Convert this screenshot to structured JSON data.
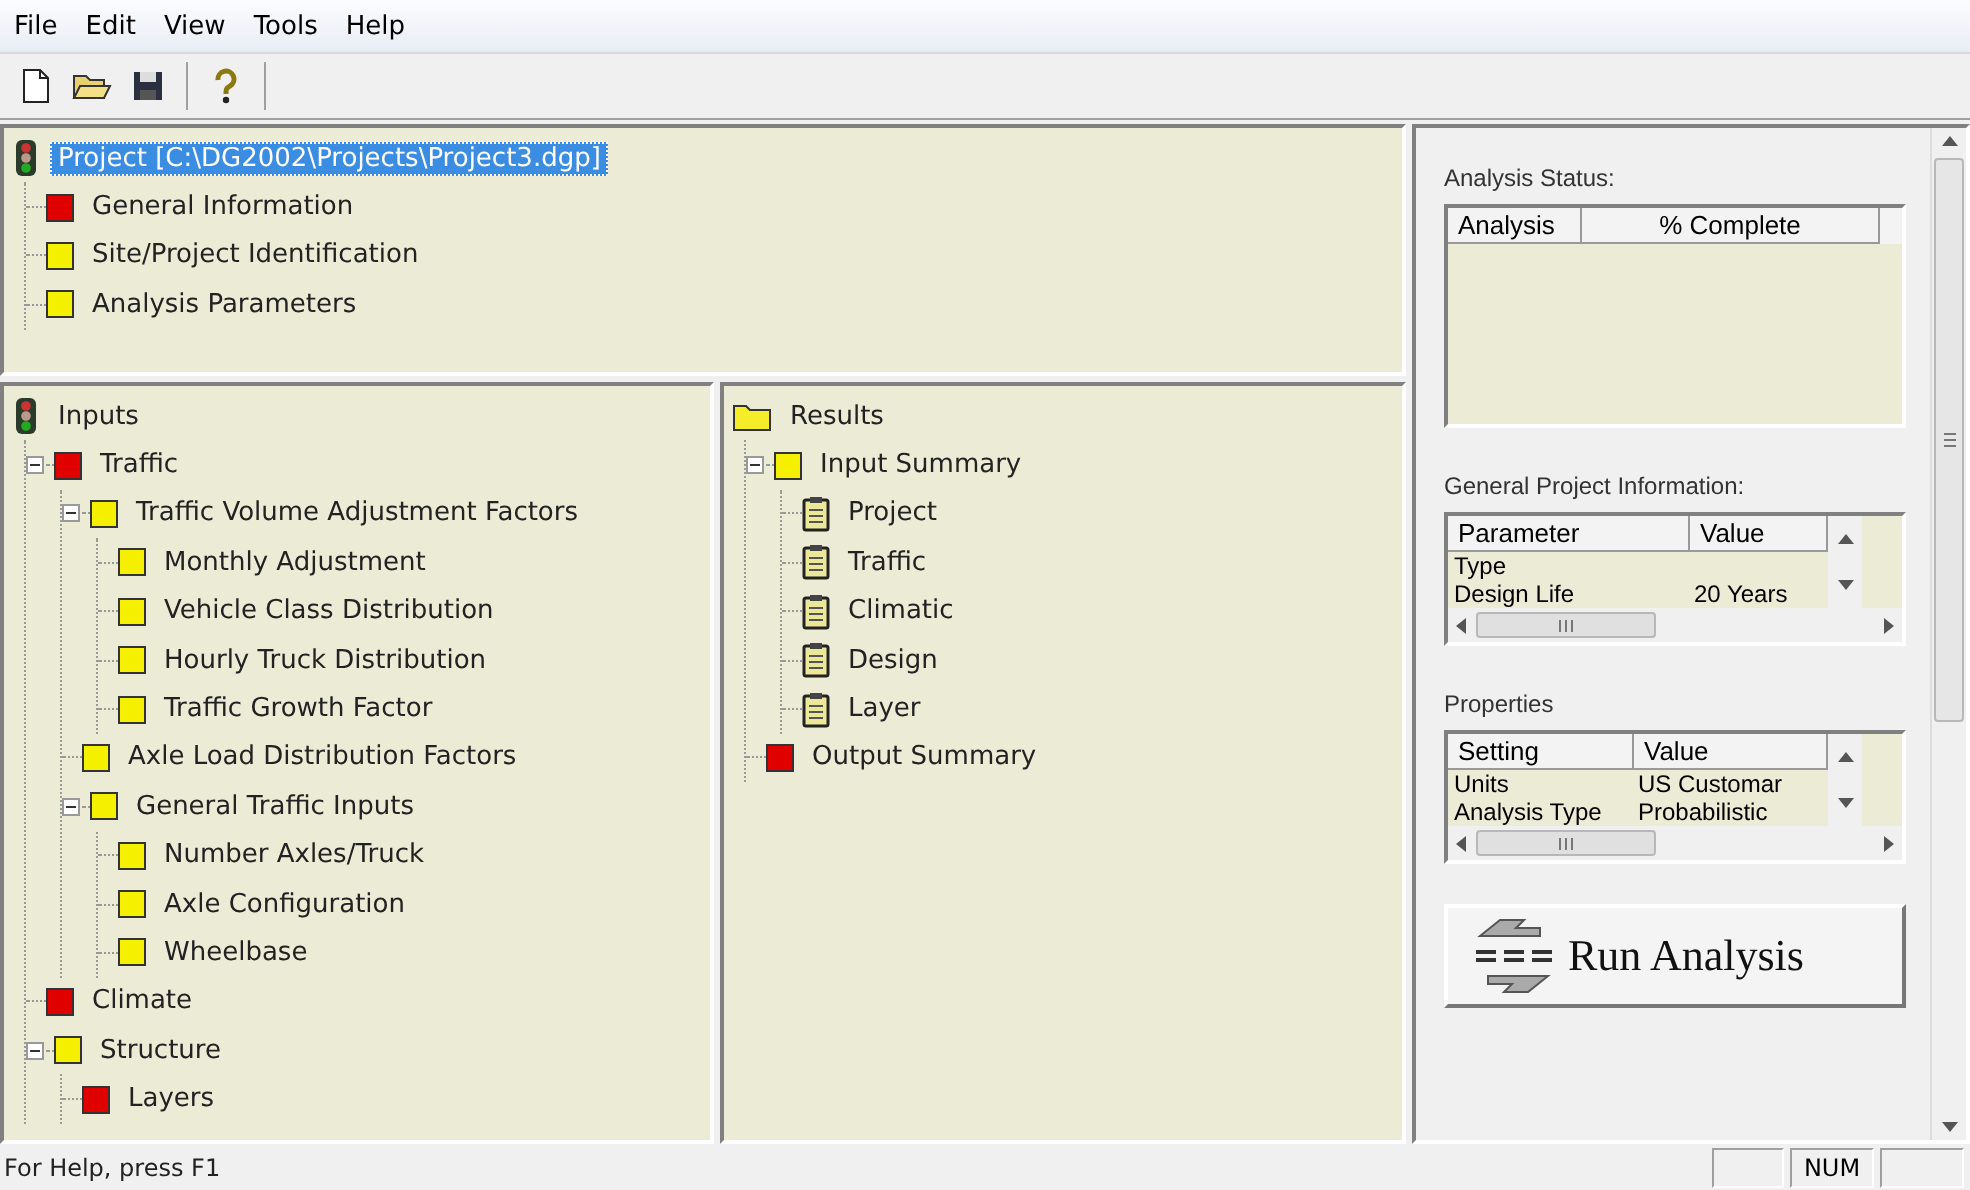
{
  "menu": [
    "File",
    "Edit",
    "View",
    "Tools",
    "Help"
  ],
  "toolbar": [
    {
      "kind": "new"
    },
    {
      "kind": "open"
    },
    {
      "kind": "save"
    },
    {
      "kind": "help"
    }
  ],
  "project_tree": [
    {
      "label": "Project [C:\\DG2002\\Projects\\Project3.dgp]",
      "kind": "traffic-light",
      "selected": true,
      "children": [
        {
          "label": "General Information",
          "kind": "square",
          "color": "#e00000",
          "selected": false
        },
        {
          "label": "Site/Project Identification",
          "kind": "square",
          "color": "#f5f000",
          "selected": false
        },
        {
          "label": "Analysis Parameters",
          "kind": "square",
          "color": "#f5f000",
          "selected": false
        }
      ]
    }
  ],
  "inputs_tree": [
    {
      "label": "Inputs",
      "kind": "traffic-light",
      "selected": false,
      "children": [
        {
          "label": "Traffic",
          "kind": "square",
          "color": "#e00000",
          "selected": false,
          "expanded": true,
          "children": [
            {
              "label": "Traffic Volume Adjustment Factors",
              "kind": "square",
              "color": "#f5f000",
              "selected": false,
              "expanded": true,
              "children": [
                {
                  "label": "Monthly Adjustment",
                  "kind": "square",
                  "color": "#f5f000",
                  "selected": false
                },
                {
                  "label": "Vehicle Class Distribution",
                  "kind": "square",
                  "color": "#f5f000",
                  "selected": false
                },
                {
                  "label": "Hourly Truck Distribution",
                  "kind": "square",
                  "color": "#f5f000",
                  "selected": false
                },
                {
                  "label": "Traffic Growth Factor",
                  "kind": "square",
                  "color": "#f5f000",
                  "selected": false
                }
              ]
            },
            {
              "label": "Axle Load Distribution Factors",
              "kind": "square",
              "color": "#f5f000",
              "selected": false
            },
            {
              "label": "General Traffic Inputs",
              "kind": "square",
              "color": "#f5f000",
              "selected": false,
              "expanded": true,
              "children": [
                {
                  "label": "Number Axles/Truck",
                  "kind": "square",
                  "color": "#f5f000",
                  "selected": false
                },
                {
                  "label": "Axle Configuration",
                  "kind": "square",
                  "color": "#f5f000",
                  "selected": false
                },
                {
                  "label": "Wheelbase",
                  "kind": "square",
                  "color": "#f5f000",
                  "selected": false
                }
              ]
            }
          ]
        },
        {
          "label": "Climate",
          "kind": "square",
          "color": "#e00000",
          "selected": false
        },
        {
          "label": "Structure",
          "kind": "square",
          "color": "#f5f000",
          "selected": false,
          "expanded": true,
          "children": [
            {
              "label": "Layers",
              "kind": "square",
              "color": "#e00000",
              "selected": false
            }
          ]
        }
      ]
    }
  ],
  "results_tree": [
    {
      "label": "Results",
      "kind": "folder",
      "selected": false,
      "children": [
        {
          "label": "Input Summary",
          "kind": "square",
          "color": "#f5f000",
          "selected": false,
          "expanded": true,
          "children": [
            {
              "label": "Project",
              "kind": "clipboard",
              "selected": false
            },
            {
              "label": "Traffic",
              "kind": "clipboard",
              "selected": false
            },
            {
              "label": "Climatic",
              "kind": "clipboard",
              "selected": false
            },
            {
              "label": "Design",
              "kind": "clipboard",
              "selected": false
            },
            {
              "label": "Layer",
              "kind": "clipboard",
              "selected": false
            }
          ]
        },
        {
          "label": "Output Summary",
          "kind": "square",
          "color": "#e00000",
          "selected": false
        }
      ]
    }
  ],
  "analysis_status": {
    "label": "Analysis Status:",
    "columns": [
      "Analysis",
      "% Complete"
    ]
  },
  "general_project_information": {
    "label": "General Project Information:",
    "columns": [
      "Parameter",
      "Value"
    ],
    "rows": [
      {
        "name": "Type"
      },
      {
        "name": "Design Life",
        "value": "20 Years"
      }
    ]
  },
  "properties": {
    "label": "Properties",
    "columns": [
      "Setting",
      "Value"
    ],
    "rows": [
      {
        "name": "Units",
        "value": "US Customar"
      },
      {
        "name": "Analysis Type",
        "value": "Probabilistic"
      }
    ]
  },
  "run_button": {
    "label": "Run Analysis"
  },
  "status_bar": {
    "help": "For Help, press F1",
    "indicators": [
      "NUM"
    ]
  }
}
